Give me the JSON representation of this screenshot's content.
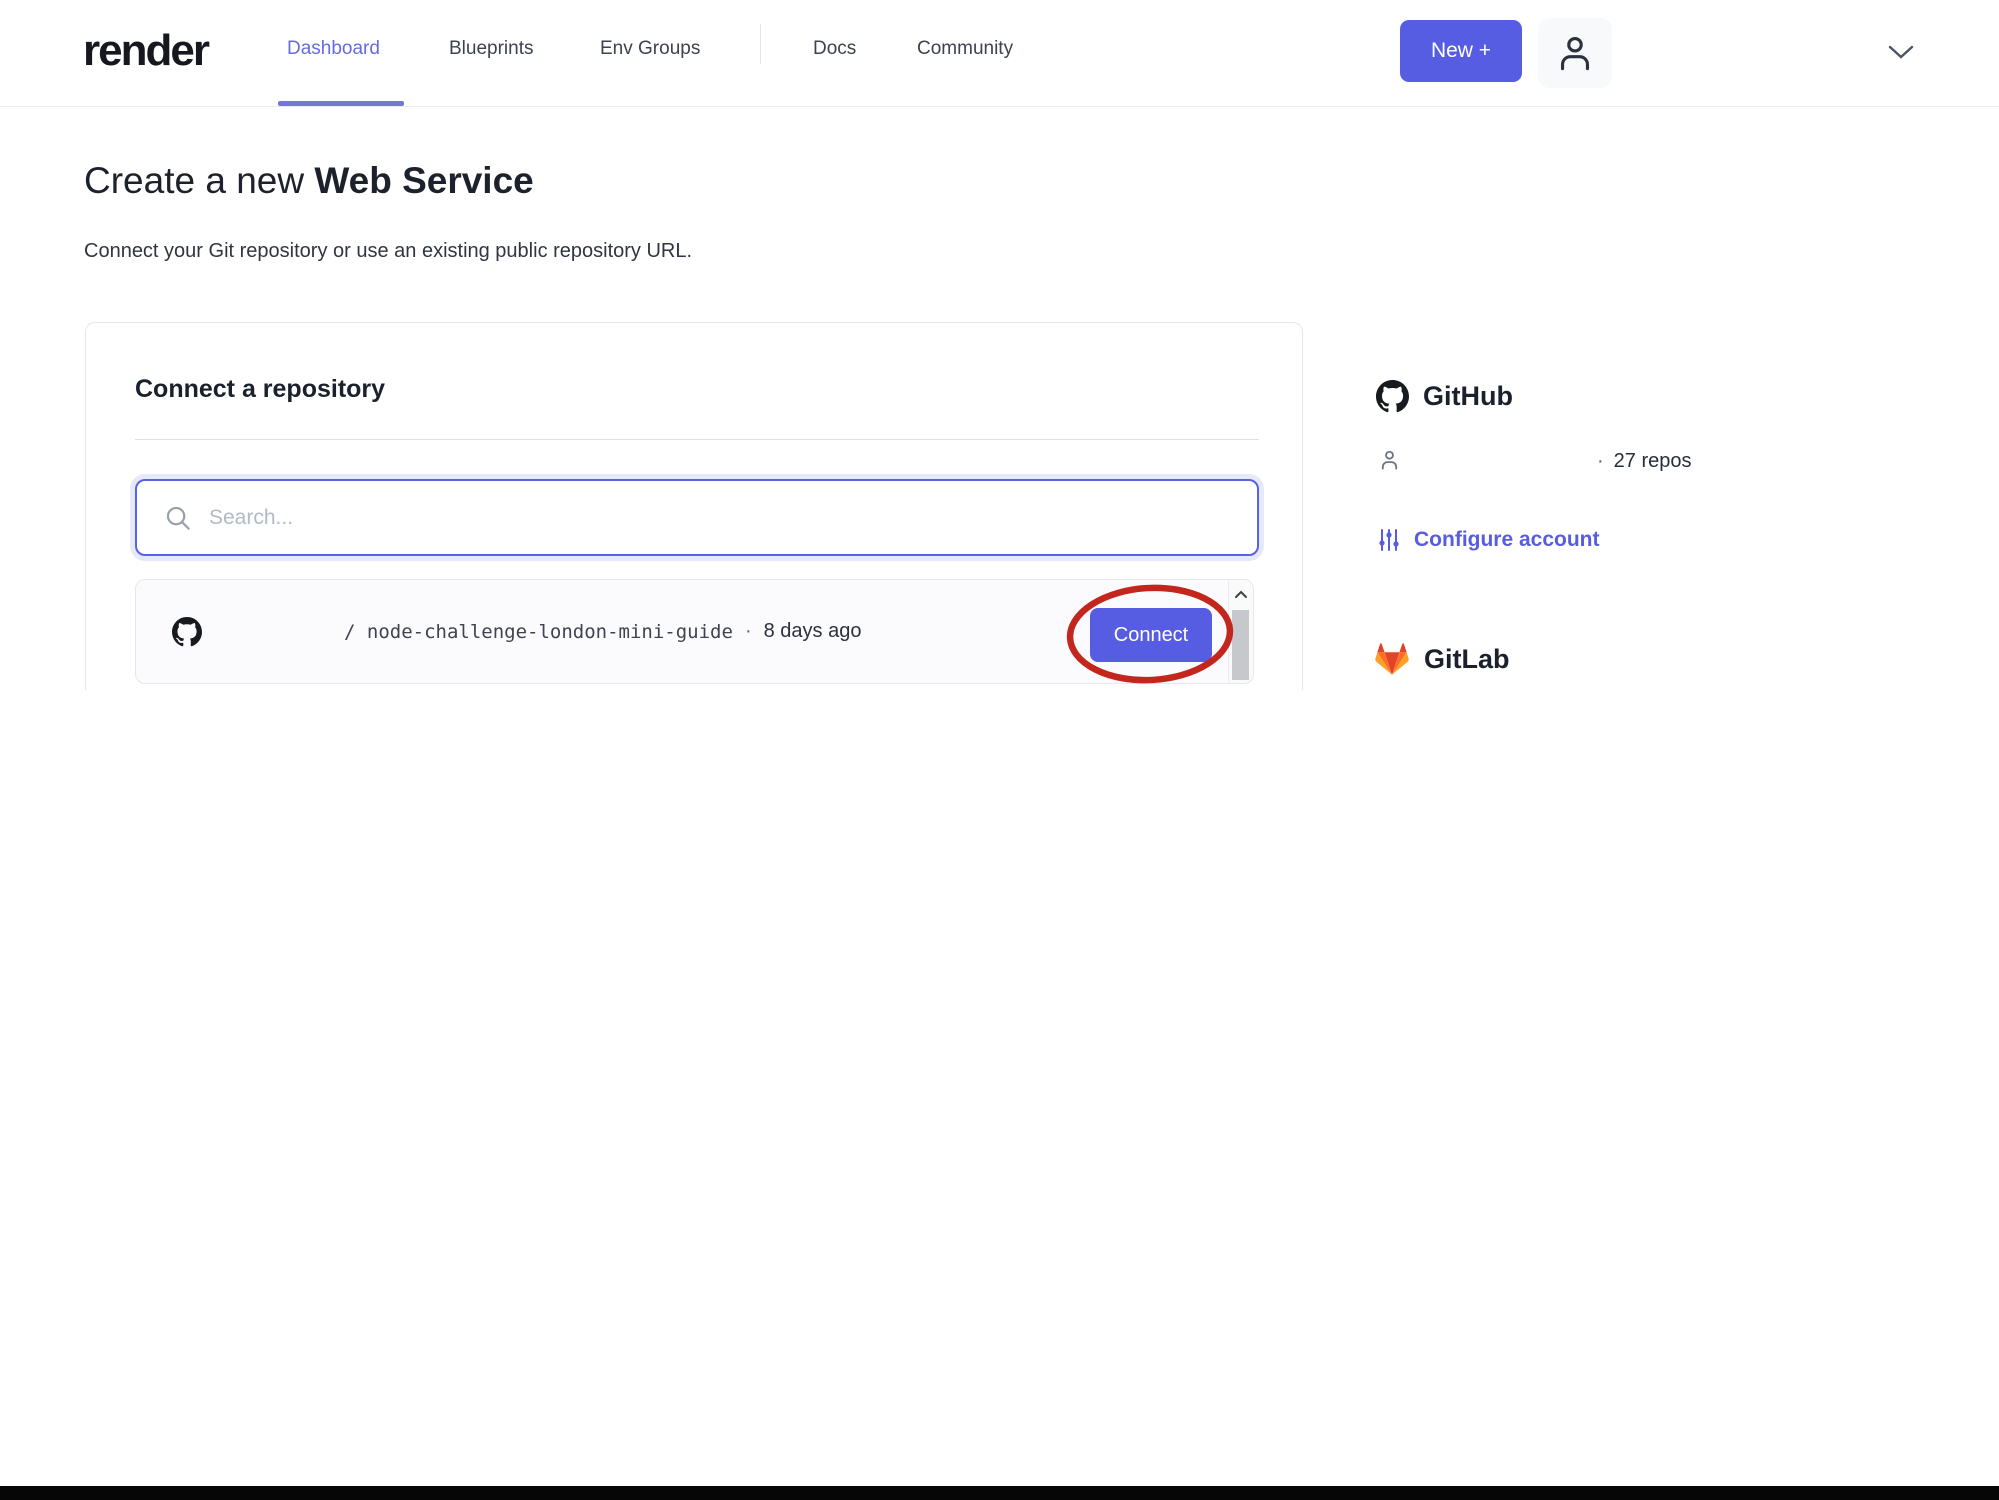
{
  "nav": {
    "logo": "render",
    "items": [
      {
        "label": "Dashboard",
        "active": true
      },
      {
        "label": "Blueprints",
        "active": false
      },
      {
        "label": "Env Groups",
        "active": false
      },
      {
        "label": "Docs",
        "active": false
      },
      {
        "label": "Community",
        "active": false
      }
    ],
    "new_button_label": "New +"
  },
  "page": {
    "title_prefix": "Create a new ",
    "title_emphasis": "Web Service",
    "subtitle": "Connect your Git repository or use an existing public repository URL."
  },
  "card": {
    "heading": "Connect a repository",
    "search_placeholder": "Search...",
    "repo": {
      "path": "/ node-challenge-london-mini-guide",
      "separator": "·",
      "updated": "8 days ago",
      "connect_label": "Connect"
    }
  },
  "sidebar": {
    "github": {
      "title": "GitHub",
      "separator": "·",
      "repos_count": "27 repos",
      "configure_label": "Configure account"
    },
    "gitlab": {
      "title": "GitLab"
    }
  },
  "colors": {
    "accent_indigo": "#575de2",
    "nav_active": "#666be0",
    "link_indigo": "#575de0",
    "annotation_red": "#c3261d",
    "gitlab_orange": "#fc6d26",
    "gitlab_red": "#e24329",
    "gitlab_yellow": "#fca326"
  }
}
